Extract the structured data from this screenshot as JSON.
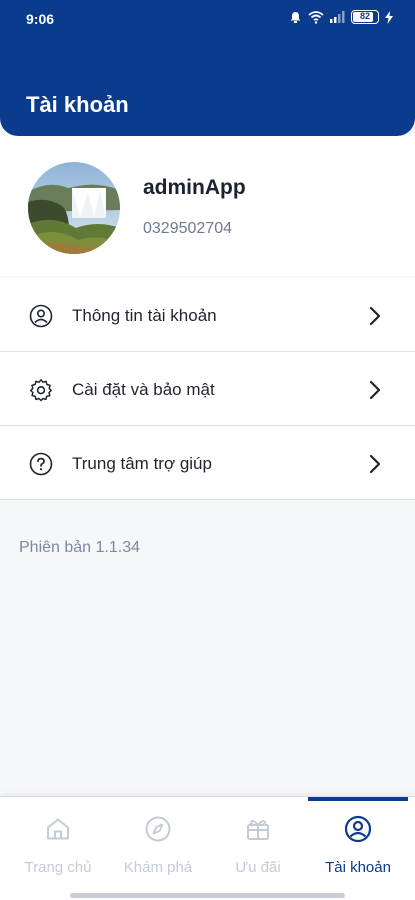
{
  "status_bar": {
    "time": "9:06",
    "battery_level": "82"
  },
  "header": {
    "title": "Tài khoản"
  },
  "profile": {
    "name": "adminApp",
    "phone": "0329502704"
  },
  "menu": [
    {
      "label": "Thông tin tài khoản",
      "icon": "user-circle-icon"
    },
    {
      "label": "Cài đặt và bảo mật",
      "icon": "gear-icon"
    },
    {
      "label": "Trung tâm trợ giúp",
      "icon": "help-circle-icon"
    }
  ],
  "version": "Phiên bản 1.1.34",
  "tabs": [
    {
      "label": "Trang chủ",
      "icon": "home-icon",
      "active": false
    },
    {
      "label": "Khám phá",
      "icon": "compass-icon",
      "active": false
    },
    {
      "label": "Ưu đãi",
      "icon": "gift-icon",
      "active": false
    },
    {
      "label": "Tài khoản",
      "icon": "user-circle-icon",
      "active": true
    }
  ],
  "colors": {
    "primary": "#0b3b8c",
    "inactive_tab": "#c4cbd7",
    "muted_text": "#6c7a92"
  }
}
